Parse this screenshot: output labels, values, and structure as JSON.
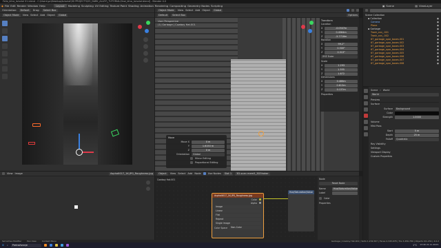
{
  "titlebar": {
    "title": "Felix_kitra_tutorial 01.blend - C:\\Users\\pc\\Desktop\\tutorial\\3D PROJECTS\\03_DARK_ALLEY\\_TUTORIAL\\final_kitra_tutorial.blend] - Blender 4.0"
  },
  "menu": [
    "File",
    "Edit",
    "Render",
    "Window",
    "Help"
  ],
  "workspaces": [
    "Layout",
    "Modeling",
    "Sculpting",
    "UV Editing",
    "Texture Paint",
    "Shading",
    "Animation",
    "Rendering",
    "Compositing",
    "Geometry Nodes",
    "Scripting"
  ],
  "active_workspace": "Layout",
  "scene": {
    "label": "Scene",
    "layer": "ViewLayer"
  },
  "left_viewport": {
    "orientation_label": "Orientation:",
    "orientation": "Default",
    "drag_label": "Drag:",
    "drag": "Select Box",
    "mode": "Object Mode",
    "view": "View",
    "select": "Select",
    "add": "Add",
    "object": "Object",
    "global": "Global"
  },
  "main_viewport": {
    "mode": "Object Mode",
    "view": "View",
    "select": "Select",
    "add": "Add",
    "object": "Object",
    "global": "Global",
    "orientation": "Default",
    "drag": "Select Box",
    "perspective": "User Perspective",
    "collection": "(1) Garbage | Cowboy Hat.001",
    "options": "Options"
  },
  "transform": {
    "header": "Transform",
    "location_label": "Location",
    "loc": [
      {
        "axis": "X",
        "val": "-0.0547m"
      },
      {
        "axis": "Y",
        "val": "0.4564m"
      },
      {
        "axis": "Z",
        "val": "-5.7716m"
      }
    ],
    "rotation_label": "Rotation",
    "rot": [
      {
        "axis": "X",
        "val": "99.2°"
      },
      {
        "axis": "Y",
        "val": "0.500°"
      },
      {
        "axis": "Z",
        "val": "0.313°"
      }
    ],
    "euler": "XYZ Euler",
    "scale_label": "Scale",
    "scl": [
      {
        "axis": "X",
        "val": "1.293"
      },
      {
        "axis": "Y",
        "val": "1.355"
      },
      {
        "axis": "Z",
        "val": "1.872"
      }
    ],
    "dim_label": "Dimensions",
    "dim": [
      {
        "axis": "X",
        "val": "0.486m"
      },
      {
        "axis": "Y",
        "val": "0.613m"
      },
      {
        "axis": "Z",
        "val": "0.137m"
      }
    ],
    "properties": "Properties"
  },
  "move_op": {
    "header": "Move",
    "fields": [
      {
        "label": "Move X",
        "val": "0 m"
      },
      {
        "label": "Y",
        "val": "1.6150 m"
      },
      {
        "label": "Z",
        "val": "0 m"
      }
    ],
    "orientation_label": "Orientation",
    "orientation": "Global",
    "mirror": "Mirror Editing",
    "proportional": "Proportional Editing"
  },
  "outliner": {
    "items": [
      {
        "name": "Scene Collection",
        "depth": 0,
        "color": "#d0d0d0"
      },
      {
        "name": "Collection",
        "depth": 1,
        "color": "#d0d0d0"
      },
      {
        "name": "Camera",
        "depth": 2,
        "color": "#7ab0ff"
      },
      {
        "name": "Plane",
        "depth": 2,
        "color": "#f0a040"
      },
      {
        "name": "Garbage",
        "depth": 1,
        "color": "#d0d0d0"
      },
      {
        "name": "Trash_can_.001",
        "depth": 2,
        "color": "#f0a040"
      },
      {
        "name": "Trash_can_.002",
        "depth": 2,
        "color": "#f0a040"
      },
      {
        "name": "67_garbage_spar_boxes.001",
        "depth": 2,
        "color": "#f0a040"
      },
      {
        "name": "67_garbage_spar_boxes.002",
        "depth": 2,
        "color": "#f0a040"
      },
      {
        "name": "67_garbage_spar_boxes.003",
        "depth": 2,
        "color": "#f0a040"
      },
      {
        "name": "67_garbage_spar_boxes.004",
        "depth": 2,
        "color": "#f0a040"
      },
      {
        "name": "67_garbage_spar_boxes.005",
        "depth": 2,
        "color": "#f0a040"
      },
      {
        "name": "67_garbage_spar_boxes.006",
        "depth": 2,
        "color": "#f0a040"
      },
      {
        "name": "67_garbage_spar_boxes.007",
        "depth": 2,
        "color": "#f0a040"
      },
      {
        "name": "67_garbage_spar_boxes.008",
        "depth": 2,
        "color": "#f0a040"
      }
    ]
  },
  "properties": {
    "scene_label": "Scene",
    "world_label": "World",
    "world_name": "World",
    "preview": "Preview",
    "surface_header": "Surface",
    "surface_label": "Surface",
    "surface_val": "Background",
    "color_label": "Color",
    "strength_label": "Strength",
    "strength_val": "1.0000",
    "volume": "Volume",
    "mist": "Mist Pass",
    "start_label": "Start",
    "start_val": "5 m",
    "depth_label": "Depth",
    "depth_val": "25 m",
    "falloff_label": "Falloff",
    "falloff_val": "Quadratic",
    "ray": "Ray Visibility",
    "settings": "Settings",
    "viewport_display": "Viewport Display",
    "custom": "Custom Properties"
  },
  "image_editor": {
    "view": "View",
    "image": "Image",
    "filename": "Asphalt017_1K-JPG_Roughness.jpg"
  },
  "node_editor": {
    "mode": "Object",
    "view": "View",
    "select": "Select",
    "add": "Add",
    "node": "Node",
    "use_nodes": "Use Nodes",
    "slot": "Slot 1",
    "material": "3D-scan mem5_3D3haker",
    "object_name": "Cowboy Hat.001",
    "image_node": "Asphalt017_1K-JPG_Roughness.jpg",
    "image_label": "Image",
    "color_label": "Color",
    "alpha_label": "Alpha",
    "linear": "Linear",
    "flat": "Flat",
    "repeat": "Repeat",
    "single_image": "Single Image",
    "color_space": "Color Space",
    "non_color": "Non-Color",
    "node_header": "Node",
    "reset_node": "Reset Node",
    "name_label": "Name",
    "name_val": "Hue/Saturation/Value",
    "label_label": "Label",
    "color_field": "Color",
    "properties": "Properties"
  },
  "statusbar": {
    "left1": "Set Active Modifier",
    "left2": "Pan View",
    "left3": "Context Menu",
    "stats": "Garbage | Cowboy Hat.001 | Verts 1,234,567 | Faces 2,345,678 | Tris 3,456,789 | Objects 0/1,234 | 4.0.2"
  },
  "taskbar": {
    "search": "Pretraživanje",
    "temp": "1°C",
    "time": "13:40",
    "date": "21.11.2023."
  }
}
